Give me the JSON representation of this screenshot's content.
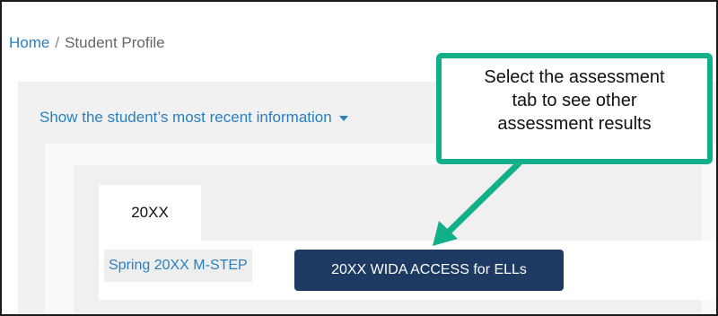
{
  "breadcrumb": {
    "home": "Home",
    "separator": "/",
    "current": "Student Profile"
  },
  "toggle": {
    "label": "Show the student’s most recent information",
    "icon": "caret-down-icon"
  },
  "year_tab": {
    "label": "20XX"
  },
  "assessment_tabs": [
    {
      "label": "Spring 20XX M-STEP",
      "active": false
    },
    {
      "label": "20XX WIDA ACCESS for ELLs",
      "active": true
    }
  ],
  "callout": {
    "lines": [
      "Select the assessment",
      "tab to see other",
      "assessment results"
    ]
  },
  "colors": {
    "link": "#2a7fbf",
    "active_tab": "#1d3a63",
    "callout_border": "#12b08a",
    "panel_bg": "#f1f1f1"
  }
}
